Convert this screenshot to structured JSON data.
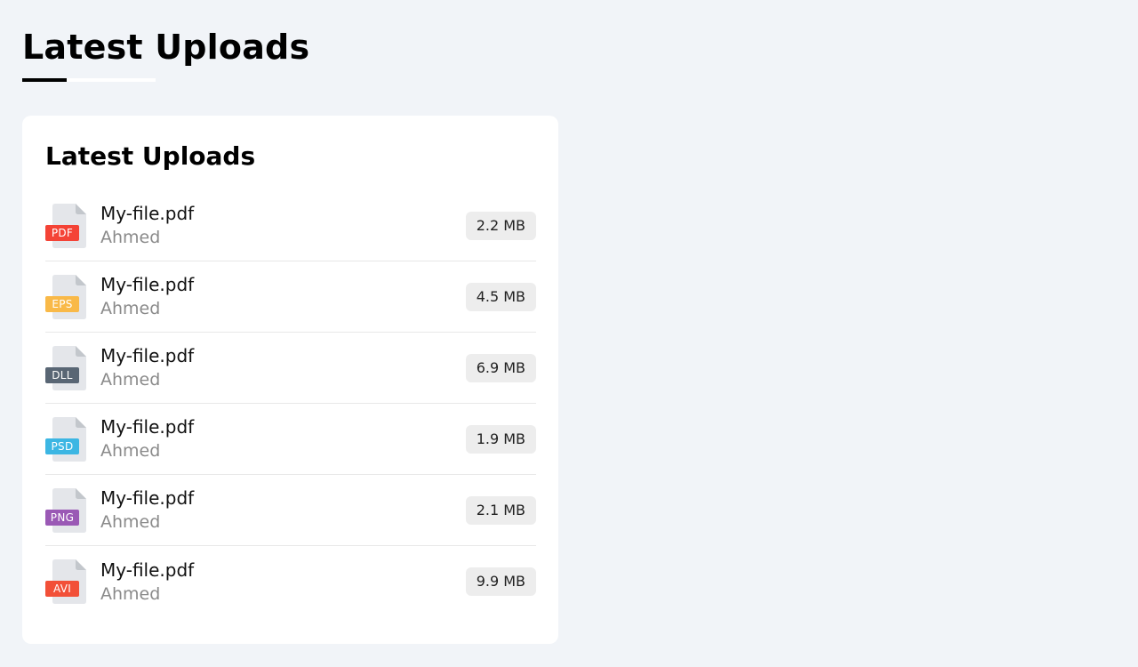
{
  "page": {
    "title": "Latest Uploads"
  },
  "card": {
    "title": "Latest Uploads"
  },
  "uploads": [
    {
      "name": "My-file.pdf",
      "owner": "Ahmed",
      "ext": "PDF",
      "size": "2.2 MB",
      "color": "#f44336"
    },
    {
      "name": "My-file.pdf",
      "owner": "Ahmed",
      "ext": "EPS",
      "size": "4.5 MB",
      "color": "#f9b948"
    },
    {
      "name": "My-file.pdf",
      "owner": "Ahmed",
      "ext": "DLL",
      "size": "6.9 MB",
      "color": "#596674"
    },
    {
      "name": "My-file.pdf",
      "owner": "Ahmed",
      "ext": "PSD",
      "size": "1.9 MB",
      "color": "#3cb6e3"
    },
    {
      "name": "My-file.pdf",
      "owner": "Ahmed",
      "ext": "PNG",
      "size": "2.1 MB",
      "color": "#9a59b5"
    },
    {
      "name": "My-file.pdf",
      "owner": "Ahmed",
      "ext": "AVI",
      "size": "9.9 MB",
      "color": "#f25038"
    }
  ],
  "colors": {
    "background": "#f1f4f8",
    "card": "#ffffff",
    "size_badge": "#ededed",
    "owner_text": "#8a8a8a"
  },
  "icons": {
    "file": "file-icon"
  }
}
